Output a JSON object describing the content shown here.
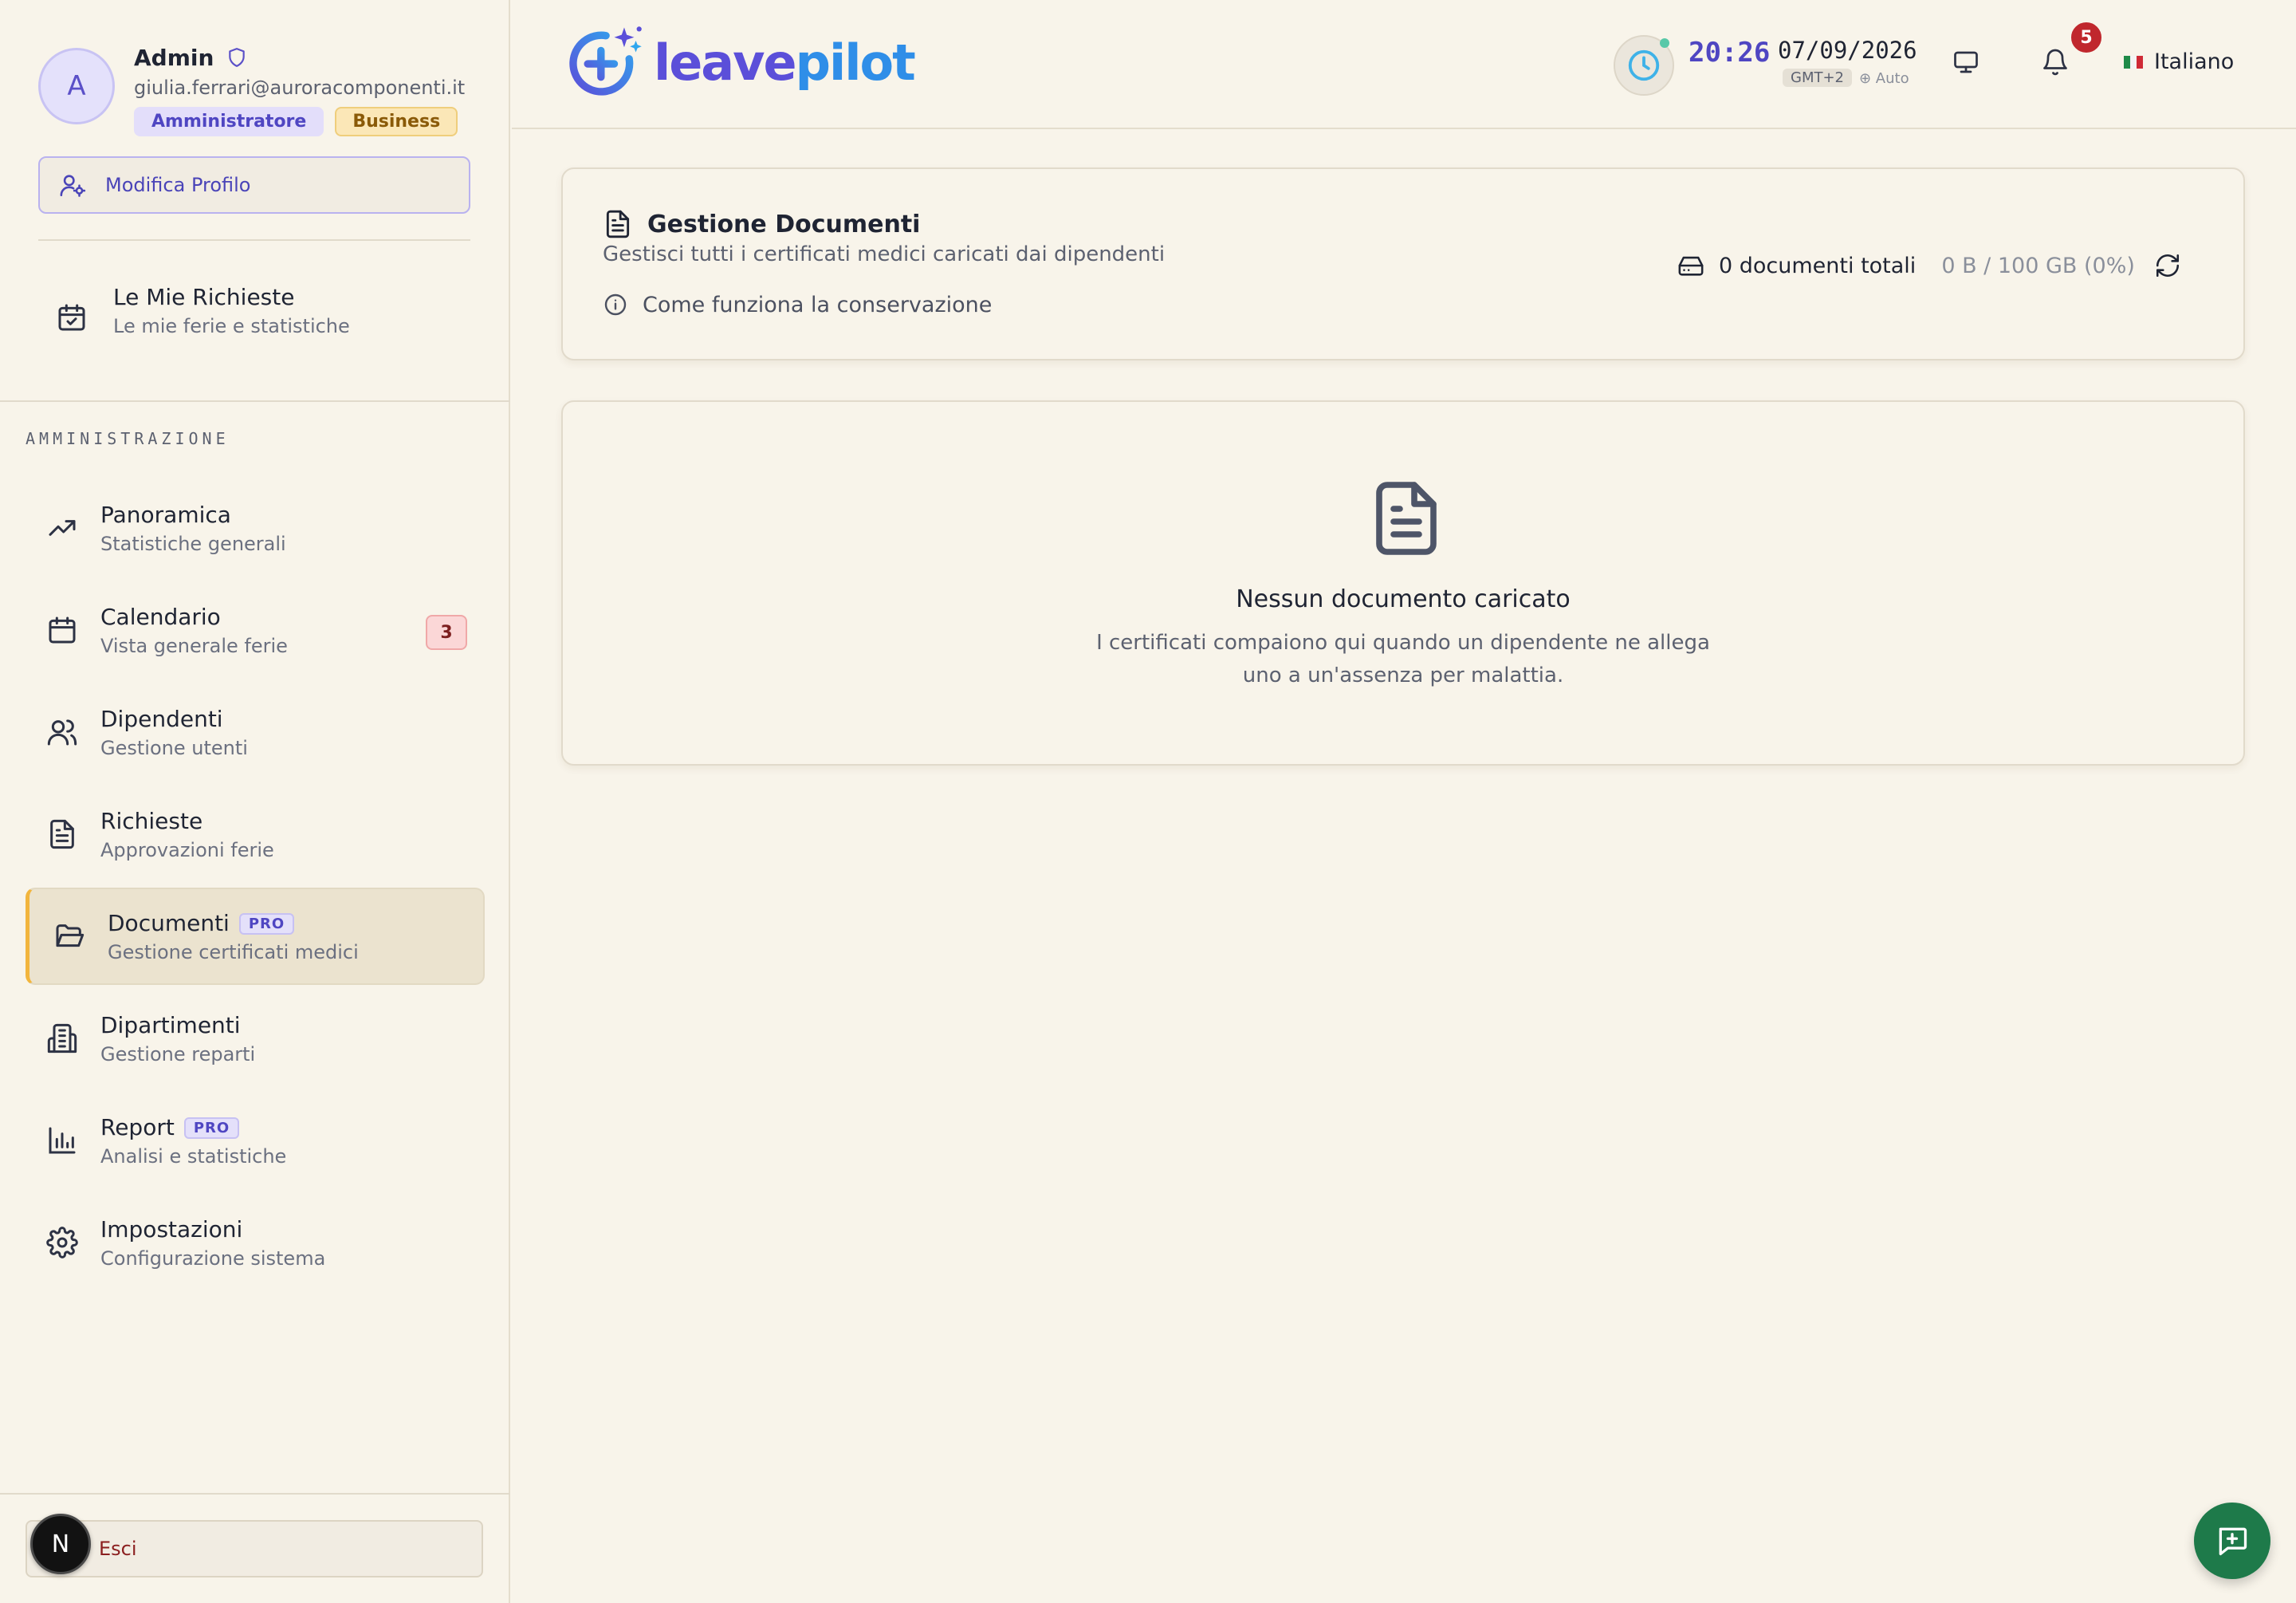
{
  "profile": {
    "avatar_initial": "A",
    "name": "Admin",
    "email": "giulia.ferrari@auroracomponenti.it",
    "role_badge": "Amministratore",
    "plan_badge": "Business",
    "edit_label": "Modifica Profilo"
  },
  "my_requests": {
    "title": "Le Mie Richieste",
    "subtitle": "Le mie ferie e statistiche"
  },
  "section_label": "AMMINISTRAZIONE",
  "nav": [
    {
      "title": "Panoramica",
      "subtitle": "Statistiche generali",
      "icon": "trending-up-icon"
    },
    {
      "title": "Calendario",
      "subtitle": "Vista generale ferie",
      "icon": "calendar-icon",
      "badge": "3"
    },
    {
      "title": "Dipendenti",
      "subtitle": "Gestione utenti",
      "icon": "users-icon"
    },
    {
      "title": "Richieste",
      "subtitle": "Approvazioni ferie",
      "icon": "file-text-icon"
    },
    {
      "title": "Documenti",
      "subtitle": "Gestione certificati medici",
      "icon": "folder-open-icon",
      "tag": "PRO",
      "active": true
    },
    {
      "title": "Dipartimenti",
      "subtitle": "Gestione reparti",
      "icon": "building-icon"
    },
    {
      "title": "Report",
      "subtitle": "Analisi e statistiche",
      "icon": "bar-chart-icon",
      "tag": "PRO"
    },
    {
      "title": "Impostazioni",
      "subtitle": "Configurazione sistema",
      "icon": "gear-icon"
    }
  ],
  "logout_label": "Esci",
  "dev_badge": "N",
  "header": {
    "logo_part1": "leave",
    "logo_part2": "pilot",
    "time": "20:26",
    "date": "07/09/2026",
    "timezone": "GMT+2",
    "tz_mode": "⊕ Auto",
    "notifications_count": "5",
    "language": "Italiano"
  },
  "documents": {
    "title": "Gestione Documenti",
    "subtitle": "Gestisci tutti i certificati medici caricati dai dipendenti",
    "info_link": "Come funziona la conservazione",
    "total_docs": "0 documenti totali",
    "storage": "0 B / 100 GB (0%)"
  },
  "empty_state": {
    "title": "Nessun documento caricato",
    "line1": "I certificati compaiono qui quando un dipendente ne allega",
    "line2": "uno a un'assenza per malattia."
  },
  "colors": {
    "background": "#f8f4ea",
    "accent": "#4f46c2",
    "active_border": "#f2b53d",
    "fab": "#1e7a4a",
    "notification": "#c0272d"
  }
}
